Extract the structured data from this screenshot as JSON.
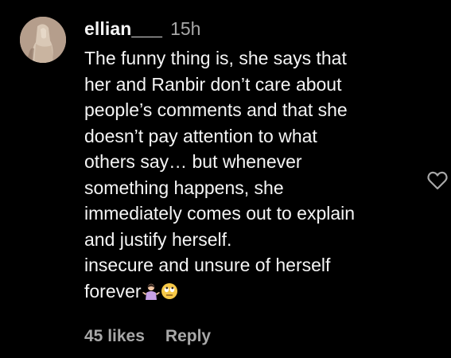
{
  "comment": {
    "username": "ellian___",
    "time": "15h",
    "text_lines": [
      "The funny thing is, she says that",
      "her and Ranbir don’t care about",
      "people’s comments and that she",
      "doesn’t pay attention to what",
      "others say… but whenever",
      "something happens, she",
      "immediately comes out to explain",
      "and justify herself.",
      "insecure and unsure of herself",
      "forever"
    ],
    "trailing_emojis": [
      "person-shrugging-emoji",
      "eye-roll-emoji"
    ],
    "likes": "45 likes",
    "reply_label": "Reply",
    "like_icon": "heart-outline-icon"
  },
  "colors": {
    "background": "#000000",
    "primary_text": "#f5f5f5",
    "secondary_text": "#a8a8a8"
  }
}
